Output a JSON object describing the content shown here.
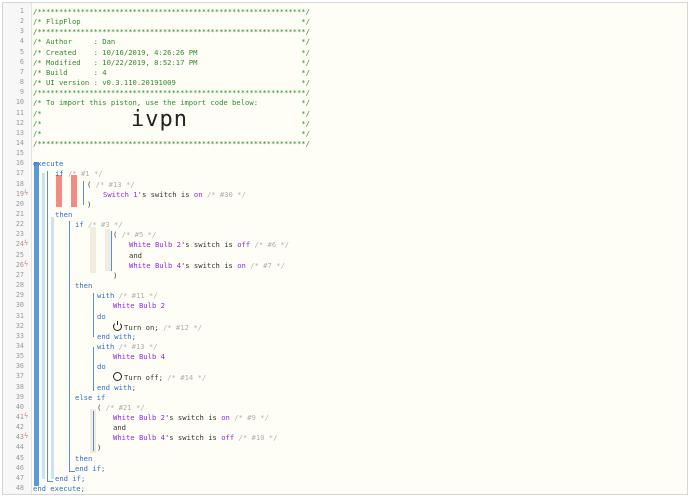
{
  "header": [
    "/**************************************************************/",
    "/* FlipFlop                                                   */",
    "/**************************************************************/",
    "/* Author     : Dan                                           */",
    "/* Created    : 10/16/2019, 4:26:26 PM                        */",
    "/* Modified   : 10/22/2019, 8:52:17 PM                        */",
    "/* Build      : 4                                             */",
    "/* UI version : v0.3.110.20191009                             */",
    "/**************************************************************/",
    "/* To import this piston, use the import code below:          */",
    "/*                                                            */",
    "/*                                                            */",
    "/*                                                            */",
    "/**************************************************************/"
  ],
  "import_code": "ivpn",
  "code": {
    "execute": "execute",
    "if1": "if",
    "if1_id": "/* #1 */",
    "paren_open_1": "(",
    "paren1_id": "/* #13 */",
    "switch1_device": "Switch 1",
    "switch1_text": "'s switch is",
    "switch1_state": "on",
    "switch1_id": "/* #30 */",
    "paren_close_1": ")",
    "then1": "then",
    "if3": "if",
    "if3_id": "/* #3 */",
    "paren_open_3": "(",
    "paren3_id": "/* #5 */",
    "wb2_device": "White Bulb 2",
    "wb2_text": "'s switch is",
    "wb2_state": "off",
    "wb2_id": "/* #6 */",
    "and1": "and",
    "wb4_device": "White Bulb 4",
    "wb4_text": "'s switch is",
    "wb4_state": "on",
    "wb4_id": "/* #7 */",
    "paren_close_3": ")",
    "then3": "then",
    "with11": "with",
    "with11_id": "/* #11 */",
    "with11_device": "White Bulb 2",
    "do11": "do",
    "turn_on": "Turn on;",
    "turn_on_id": "/* #12 */",
    "endwith11": "end with;",
    "with13": "with",
    "with13_id": "/* #13 */",
    "with13_device": "White Bulb 4",
    "do13": "do",
    "turn_off": "Turn off;",
    "turn_off_id": "/* #14 */",
    "endwith13": "end with;",
    "elseif": "else if",
    "paren_open_21": "(",
    "paren21_id": "/* #21 */",
    "wb2b_device": "White Bulb 2",
    "wb2b_text": "'s switch is",
    "wb2b_state": "on",
    "wb2b_id": "/* #9 */",
    "and2": "and",
    "wb4b_device": "White Bulb 4",
    "wb4b_text": "'s switch is",
    "wb4b_state": "off",
    "wb4b_id": "/* #10 */",
    "paren_close_21": ")",
    "then21": "then",
    "endif3": "end if;",
    "endif1": "end if;",
    "endexecute": "end execute;"
  },
  "line_numbers": [
    "1",
    "2",
    "3",
    "4",
    "5",
    "6",
    "7",
    "8",
    "9",
    "10",
    "11",
    "12",
    "13",
    "14",
    "15",
    "16",
    "17",
    "18",
    "19",
    "20",
    "21",
    "22",
    "23",
    "24",
    "25",
    "26",
    "27",
    "28",
    "29",
    "30",
    "31",
    "32",
    "33",
    "34",
    "35",
    "36",
    "37",
    "38",
    "39",
    "40",
    "41",
    "42",
    "43",
    "44",
    "45",
    "46",
    "47",
    "48"
  ],
  "trigger_lines": [
    "19",
    "24",
    "26",
    "41",
    "43"
  ],
  "trigger_icon": "lightning-icon",
  "colors": {
    "comment": "#2e8b2e",
    "keyword": "#2f6ec8",
    "device": "#8a2be2",
    "block_bar": "#5b9bd5",
    "trigger_bar": "#f28b82",
    "restriction_bar": "#f0ede0",
    "trigger_bolt": "#e07a5f"
  }
}
